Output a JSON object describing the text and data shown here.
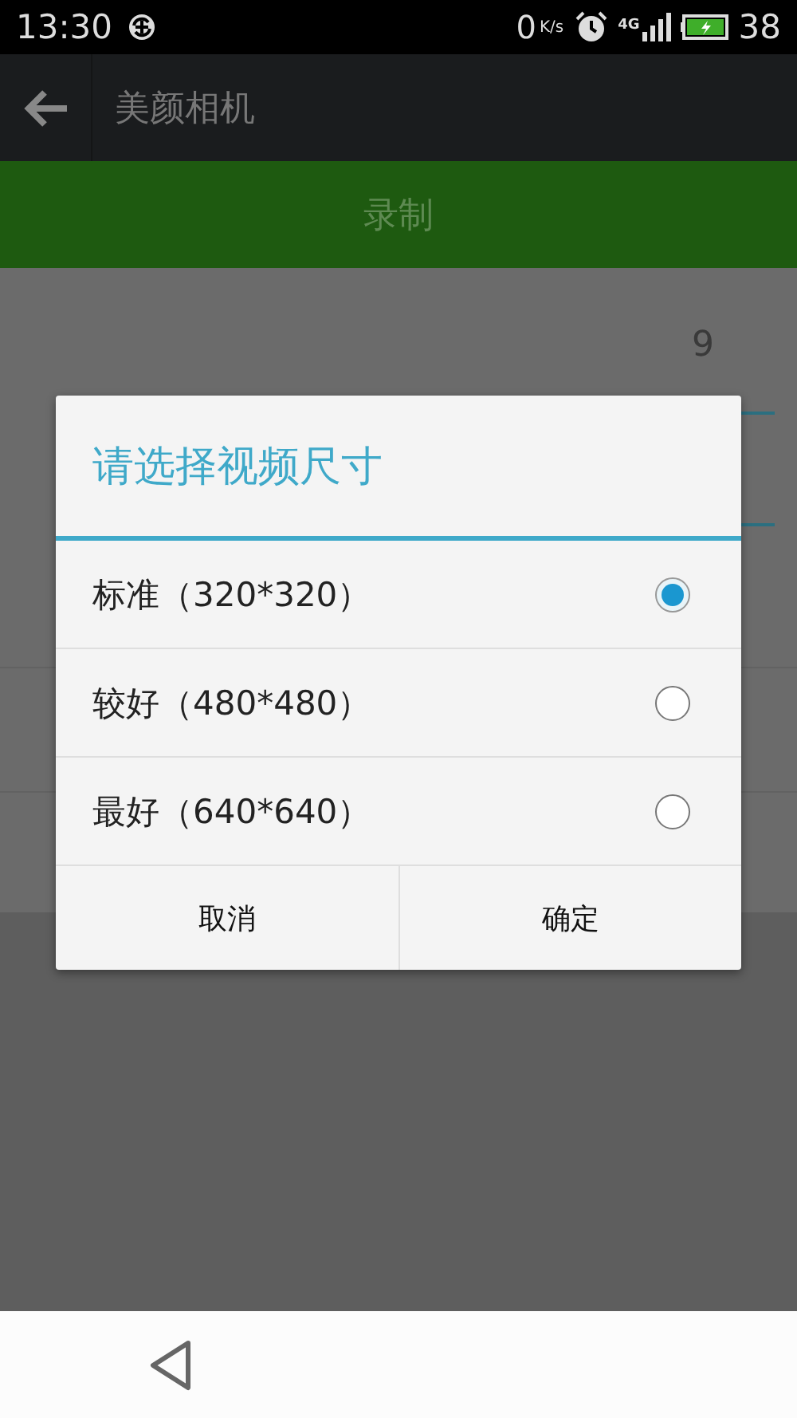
{
  "status_bar": {
    "time": "13:30",
    "net_speed": "0",
    "net_unit": "K/s",
    "network": "4G",
    "battery": "38"
  },
  "app_bar": {
    "title": "美颜相机"
  },
  "record_button": {
    "label": "录制"
  },
  "background": {
    "value": "9"
  },
  "dialog": {
    "title": "请选择视频尺寸",
    "options": [
      {
        "label": "标准（320*320）",
        "selected": true
      },
      {
        "label": "较好（480*480）",
        "selected": false
      },
      {
        "label": "最好（640*640）",
        "selected": false
      }
    ],
    "buttons": [
      "取消",
      "确定"
    ]
  }
}
